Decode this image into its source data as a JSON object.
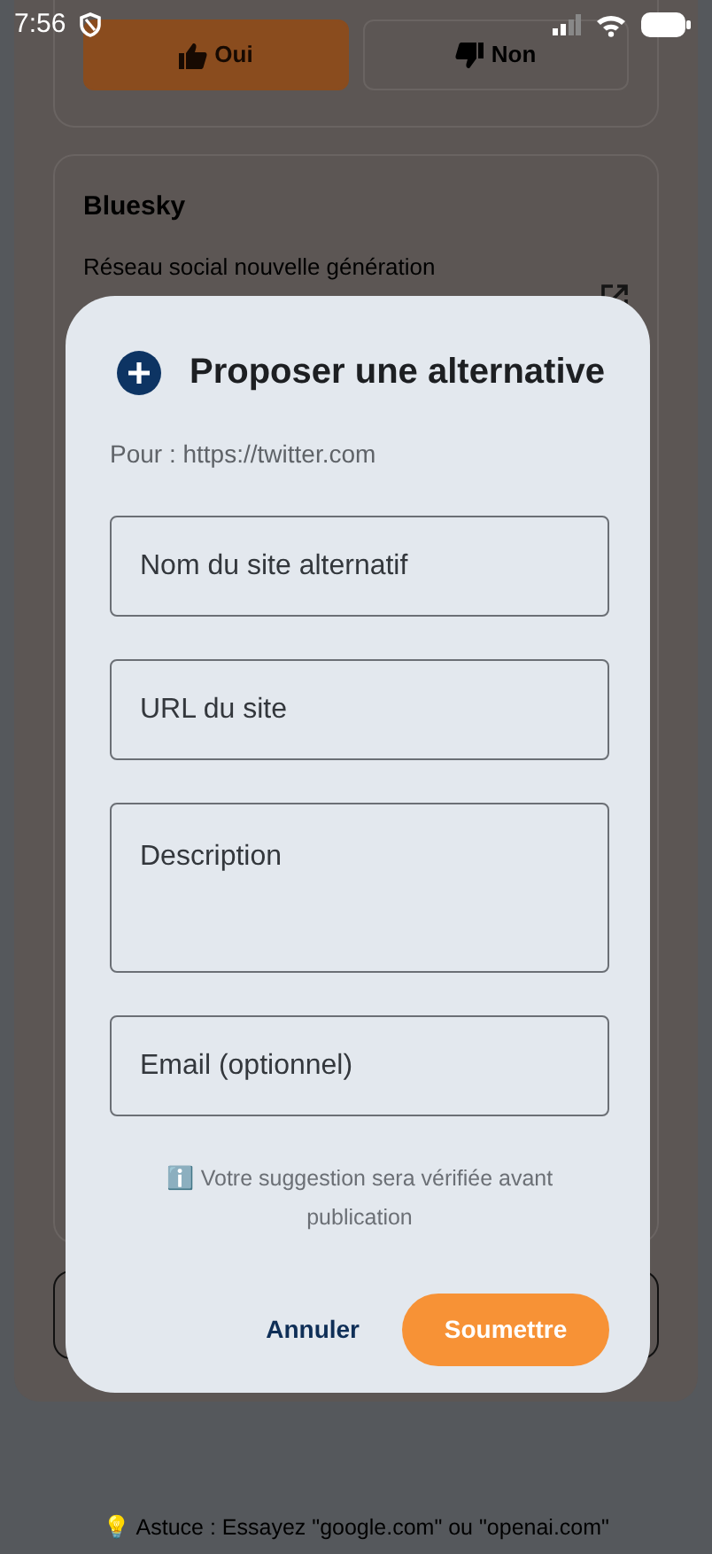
{
  "status_bar": {
    "time": "7:56"
  },
  "background": {
    "vote_buttons": [
      {
        "label": "Oui",
        "kind": "up",
        "selected": true
      },
      {
        "label": "Non",
        "kind": "down",
        "selected": false
      }
    ],
    "card": {
      "title": "Bluesky",
      "description": "Réseau social nouvelle génération"
    },
    "tip": "💡 Astuce : Essayez \"google.com\" ou \"openai.com\""
  },
  "dialog": {
    "title": "Proposer une alternative",
    "subtitle": "Pour : https://twitter.com",
    "fields": [
      {
        "placeholder": "Nom du site alternatif",
        "kind": "single"
      },
      {
        "placeholder": "URL du site",
        "kind": "single"
      },
      {
        "placeholder": "Description",
        "kind": "multiline"
      },
      {
        "placeholder": "Email (optionnel)",
        "kind": "single"
      }
    ],
    "note": "ℹ️ Votre suggestion sera vérifiée avant publication",
    "buttons": [
      {
        "label": "Annuler",
        "kind": "text"
      },
      {
        "label": "Soumettre",
        "kind": "filled"
      }
    ]
  }
}
